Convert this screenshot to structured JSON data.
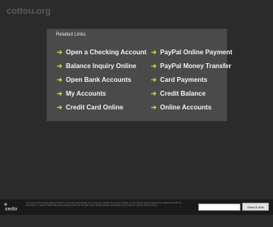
{
  "site": {
    "title": "cottou.org"
  },
  "related": {
    "heading": "Related Links",
    "left_links": [
      {
        "label": "Open a Checking Account"
      },
      {
        "label": "Balance Inquiry Online"
      },
      {
        "label": "Open Bank Accounts"
      },
      {
        "label": "My Accounts"
      },
      {
        "label": "Credit Card Online"
      }
    ],
    "right_links": [
      {
        "label": "PayPal Online Payment"
      },
      {
        "label": "PayPal Money Transfer"
      },
      {
        "label": "Card Payments"
      },
      {
        "label": "Credit Balance"
      },
      {
        "label": "Online Accounts"
      }
    ],
    "arrow_glyph": "➔"
  },
  "footer": {
    "logo_text": "sedo",
    "disclaimer": "The Sponsored Listings displayed above are served automatically by a third party. Neither the service provider nor the domain owner maintain any relationship with the advertisers. In case of trademark issues please contact the domain owner directly (contact information can be found in whois). Privacy Policy",
    "search_placeholder": "",
    "search_button_label": "Search Ads"
  },
  "colors": {
    "background": "#2b2b2b",
    "panel": "#4a4a4a",
    "accent_arrow": "#b7de3d",
    "link_text": "#f2f2f2"
  }
}
